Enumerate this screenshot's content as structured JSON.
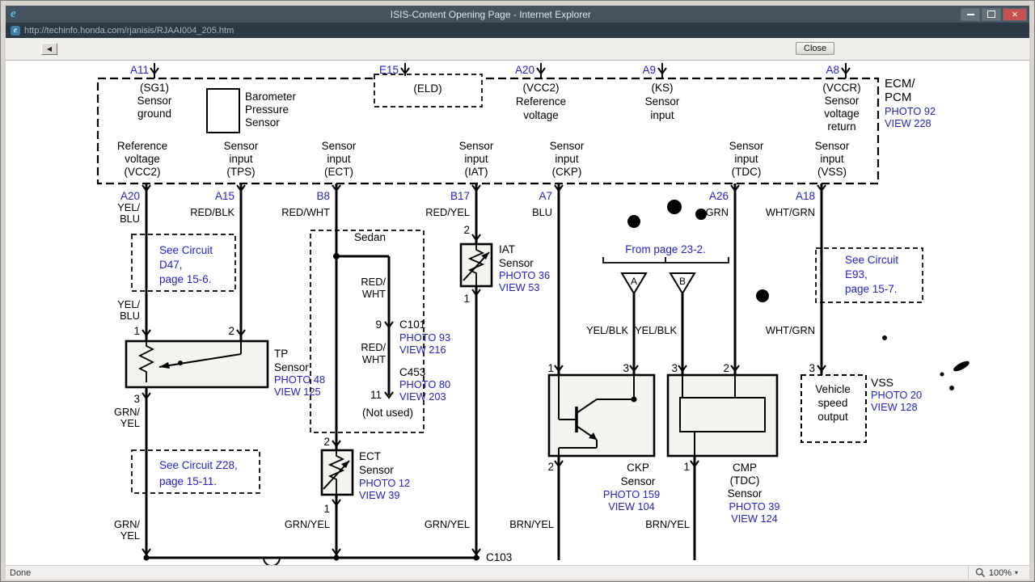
{
  "chrome": {
    "title": "ISIS-Content Opening Page - Internet Explorer",
    "url": "http://techinfo.honda.com/rjanisis/RJAAI004_205.htm",
    "back_arrow": "◀",
    "close_button": "Close",
    "close_x": "×",
    "status": "Done",
    "zoom": "100%"
  },
  "colors": {
    "link": "#2222c8",
    "titlebar": "#44535f",
    "addressbar": "#2b3945",
    "close_red": "#c75050",
    "chrome_bg": "#f0efec",
    "box_fill": "#f3f3f0"
  },
  "ecm": {
    "name1": "ECM/",
    "name2": "PCM",
    "photo": "PHOTO 92",
    "view": "VIEW 228"
  },
  "top": {
    "a11": "A11",
    "sg1": "(SG1)",
    "sg1_1": "Sensor",
    "sg1_2": "ground",
    "baro1": "Barometer",
    "baro2": "Pressure",
    "baro3": "Sensor",
    "e15": "E15",
    "eld": "(ELD)",
    "a20": "A20",
    "vcc2": "(VCC2)",
    "vcc2_1": "Reference",
    "vcc2_2": "voltage",
    "a9": "A9",
    "ks": "(KS)",
    "ks_1": "Sensor",
    "ks_2": "input",
    "a8": "A8",
    "vccr": "(VCCR)",
    "vccr_1": "Sensor",
    "vccr_2": "voltage",
    "vccr_3": "return"
  },
  "row": {
    "vcc2": [
      "Reference",
      "voltage",
      "(VCC2)"
    ],
    "tps": [
      "Sensor",
      "input",
      "(TPS)"
    ],
    "ect": [
      "Sensor",
      "input",
      "(ECT)"
    ],
    "iat": [
      "Sensor",
      "input",
      "(IAT)"
    ],
    "ckp": [
      "Sensor",
      "input",
      "(CKP)"
    ],
    "tdc": [
      "Sensor",
      "input",
      "(TDC)"
    ],
    "vss": [
      "Sensor",
      "input",
      "(VSS)"
    ]
  },
  "pins": {
    "a20": "A20",
    "a15": "A15",
    "b8": "B8",
    "b17": "B17",
    "a7": "A7",
    "a26": "A26",
    "a18": "A18"
  },
  "wire": {
    "yel1": "YEL/",
    "blu1": "BLU",
    "red_blk": "RED/BLK",
    "red_wht": "RED/WHT",
    "red_yel": "RED/YEL",
    "blu": "BLU",
    "grn": "GRN",
    "wht_grn": "WHT/GRN",
    "yel2": "YEL/",
    "blu2": "BLU",
    "grn1": "GRN/",
    "yel3": "YEL",
    "grn2": "GRN/",
    "yel4": "YEL",
    "red1": "RED/",
    "wht1": "WHT",
    "red2": "RED/",
    "wht2": "WHT",
    "grn_yel_ect": "GRN/YEL",
    "grn_yel_iat": "GRN/YEL",
    "yel_blk_a": "YEL/BLK",
    "yel_blk_b": "YEL/BLK",
    "brn_yel_a": "BRN/YEL",
    "brn_yel_b": "BRN/YEL",
    "wht_grn2": "WHT/GRN"
  },
  "link": {
    "d47": [
      "See Circuit",
      "D47,",
      "page 15-6."
    ],
    "z28": [
      "See Circuit Z28,",
      "page 15-11."
    ],
    "e93": [
      "See Circuit",
      "E93,",
      "page 15-7."
    ],
    "from_page": "From page 23-2."
  },
  "conn": {
    "c101": "C101",
    "c101_photo": "PHOTO 93",
    "c101_view": "VIEW 216",
    "c453": "C453",
    "c453_photo": "PHOTO 80",
    "c453_view": "VIEW 203",
    "c103": "C103",
    "not_used": "(Not used)",
    "sedan": "Sedan"
  },
  "sensor": {
    "tp1": "TP",
    "tp2": "Sensor",
    "tp_photo": "PHOTO 48",
    "tp_view": "VIEW 125",
    "ect1": "ECT",
    "ect2": "Sensor",
    "ect_photo": "PHOTO 12",
    "ect_view": "VIEW 39",
    "iat1": "IAT",
    "iat2": "Sensor",
    "iat_photo": "PHOTO 36",
    "iat_view": "VIEW 53",
    "ckp1": "CKP",
    "ckp2": "Sensor",
    "ckp_photo": "PHOTO 159",
    "ckp_view": "VIEW 104",
    "cmp1": "CMP",
    "cmp2": "(TDC)",
    "cmp3": "Sensor",
    "cmp_photo": "PHOTO 39",
    "cmp_view": "VIEW 124",
    "vss": "VSS",
    "vss_photo": "PHOTO 20",
    "vss_view": "VIEW 128",
    "vss_box": [
      "Vehicle",
      "speed",
      "output"
    ]
  },
  "num": {
    "n1": "1",
    "n2": "2",
    "n3": "3",
    "n9": "9",
    "n11": "11",
    "a": "A",
    "b": "B"
  }
}
